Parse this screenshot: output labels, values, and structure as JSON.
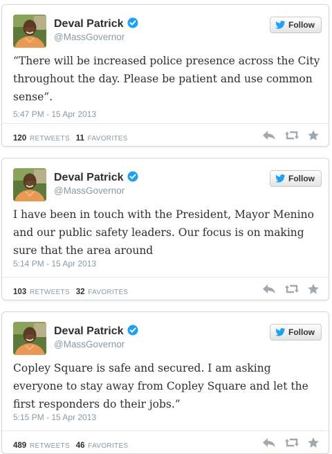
{
  "author": {
    "name": "Deval Patrick",
    "handle": "@MassGovernor"
  },
  "follow_label": "Follow",
  "icons": {
    "verified": "verified-badge-icon",
    "follow": "twitter-bird-icon",
    "reply": "reply-icon",
    "retweet": "retweet-icon",
    "favorite": "favorite-star-icon"
  },
  "colors": {
    "verified_badge": "#1da1f2",
    "bird": "#1da1f2",
    "action_icons": "#a0a8b0",
    "shirt": "#e89a55",
    "name_text": "#292f33",
    "muted_text": "#8899a6"
  },
  "tweets": [
    {
      "text": "“There will be increased police presence across the City throughout the day.  Please be patient and use common sense”.",
      "timestamp": "5:47 PM - 15 Apr 2013",
      "retweets": "120",
      "retweets_label": "Retweets",
      "favorites": "11",
      "favorites_label": "Favorites"
    },
    {
      "text": "I have been in touch with the President, Mayor Menino and our public safety leaders. Our focus is on making sure that the area around",
      "timestamp": "5:14 PM - 15 Apr 2013",
      "retweets": "103",
      "retweets_label": "Retweets",
      "favorites": "32",
      "favorites_label": "Favorites"
    },
    {
      "text": "Copley Square is safe and secured. I am asking everyone to stay away from Copley Square and let the first responders do their jobs.”",
      "timestamp": "5:15 PM - 15 Apr 2013",
      "retweets": "489",
      "retweets_label": "Retweets",
      "favorites": "46",
      "favorites_label": "Favorites"
    }
  ]
}
